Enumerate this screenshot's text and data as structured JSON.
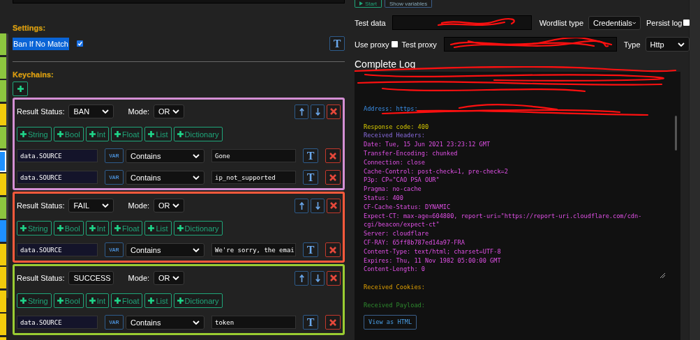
{
  "block_strip": [
    {
      "color": "#8dc63f",
      "selected": false
    },
    {
      "color": "#8dc63f",
      "selected": false
    },
    {
      "color": "#8dc63f",
      "selected": false
    },
    {
      "color": "#f2cc0c",
      "selected": false
    },
    {
      "color": "#8dc63f",
      "selected": false
    },
    {
      "color": "#1e90ff",
      "selected": true
    },
    {
      "color": "#f2cc0c",
      "selected": false
    },
    {
      "color": "#8dc63f",
      "selected": false
    },
    {
      "color": "#1e90ff",
      "selected": false
    },
    {
      "color": "#f2cc0c",
      "selected": false
    },
    {
      "color": "#f2cc0c",
      "selected": false
    },
    {
      "color": "#f2cc0c",
      "selected": false
    },
    {
      "color": "#f2cc0c",
      "selected": false
    },
    {
      "color": "#f2cc0c",
      "selected": false
    }
  ],
  "settings": {
    "title": "Settings:",
    "option": {
      "label": "Ban If No Match",
      "checked": true
    },
    "toggle": "T"
  },
  "keychains_title": "Keychains:",
  "keychains": [
    {
      "status": "BAN",
      "mode_label": "Mode:",
      "status_label": "Result Status:",
      "mode": "OR",
      "color": "#d48fd4",
      "type_buttons": [
        "String",
        "Bool",
        "Int",
        "Float",
        "List",
        "Dictionary"
      ],
      "conditions": [
        {
          "left": "data.SOURCE",
          "var": "VAR",
          "comparison": "Contains",
          "right": "Gone",
          "toggle": "T"
        },
        {
          "left": "data.SOURCE",
          "var": "VAR",
          "comparison": "Contains",
          "right": "ip_not_supported",
          "toggle": "T"
        }
      ]
    },
    {
      "status": "FAIL",
      "mode_label": "Mode:",
      "status_label": "Result Status:",
      "mode": "OR",
      "color": "#ff5a3c",
      "type_buttons": [
        "String",
        "Bool",
        "Int",
        "Float",
        "List",
        "Dictionary"
      ],
      "conditions": [
        {
          "left": "data.SOURCE",
          "var": "VAR",
          "comparison": "Contains",
          "right": "We're sorry, the emai",
          "toggle": "T"
        }
      ]
    },
    {
      "status": "SUCCESS",
      "mode_label": "Mode:",
      "status_label": "Result Status:",
      "mode": "OR",
      "color": "#9acd32",
      "type_buttons": [
        "String",
        "Bool",
        "Int",
        "Float",
        "List",
        "Dictionary"
      ],
      "conditions": [
        {
          "left": "data.SOURCE",
          "var": "VAR",
          "comparison": "Contains",
          "right": "token",
          "toggle": "T"
        }
      ]
    }
  ],
  "debugger": {
    "buttons": [
      {
        "label": "Start",
        "kind": "start"
      },
      {
        "label": "Show variables",
        "kind": "plain"
      }
    ],
    "test_data": {
      "label": "Test data"
    },
    "wordlist_type": {
      "label": "Wordlist type",
      "value": "Credentials"
    },
    "persist_log": {
      "label": "Persist log",
      "checked": false
    },
    "use_proxy": {
      "label": "Use proxy",
      "checked": false
    },
    "test_proxy": {
      "label": "Test proxy"
    },
    "proxy_type": {
      "label": "Type",
      "value": "Http"
    },
    "log_title": "Complete Log",
    "log": [
      {
        "kind": "address",
        "text": "Address: https:"
      },
      {
        "kind": "response",
        "text": "Response code: 400"
      },
      {
        "kind": "headers_title",
        "text": "Received Headers:"
      },
      {
        "kind": "header",
        "text": "Date: Tue, 15 Jun 2021 23:23:12 GMT"
      },
      {
        "kind": "header",
        "text": "Transfer-Encoding: chunked"
      },
      {
        "kind": "header",
        "text": "Connection: close"
      },
      {
        "kind": "header",
        "text": "Cache-Control: post-check=1, pre-check=2"
      },
      {
        "kind": "header",
        "text": "P3p: CP=\"CAO PSA OUR\""
      },
      {
        "kind": "header",
        "text": "Pragma: no-cache"
      },
      {
        "kind": "header",
        "text": "Status: 400"
      },
      {
        "kind": "header",
        "text": "CF-Cache-Status: DYNAMIC"
      },
      {
        "kind": "header",
        "text": "Expect-CT: max-age=604800, report-uri=\"https://report-uri.cloudflare.com/cdn-cgi/beacon/expect-ct\""
      },
      {
        "kind": "header",
        "text": "Server: cloudflare"
      },
      {
        "kind": "header",
        "text": "CF-RAY: 65ff8b787ed14a97-FRA"
      },
      {
        "kind": "header",
        "text": "Content-Type: text/html; charset=UTF-8"
      },
      {
        "kind": "header",
        "text": "Expires: Thu, 11 Nov 1982 05:00:00 GMT"
      },
      {
        "kind": "header",
        "text": "Content-Length: 0"
      },
      {
        "kind": "cookies",
        "text": "Received Cookies:"
      },
      {
        "kind": "payload",
        "text": "Received Payload:"
      }
    ],
    "view_button": "View as HTML"
  }
}
